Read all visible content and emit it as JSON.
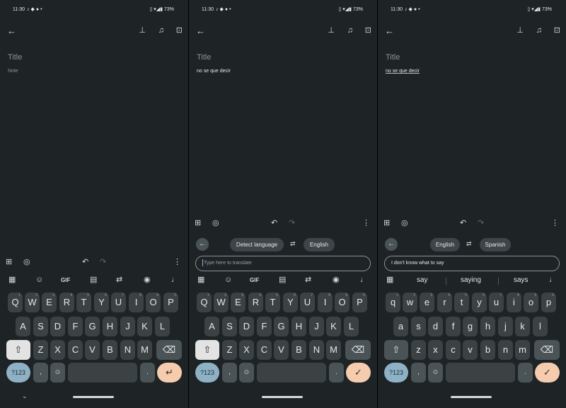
{
  "status": {
    "time": "11:30",
    "battery": "73%"
  },
  "icons": {
    "status_left": "notification-icons",
    "status_right": "wifi-signal-battery-icons",
    "back": "arrow-back-icon",
    "pin": "pin-icon",
    "reminder": "bell-plus-icon",
    "archive": "archive-icon",
    "add": "add-box-icon",
    "palette": "palette-icon",
    "undo": "undo-icon",
    "redo": "redo-icon",
    "more": "more-vert-icon",
    "apps": "apps-grid-icon",
    "sticker": "sticker-icon",
    "clipboard": "clipboard-icon",
    "translate": "translate-icon",
    "theme": "palette-icon",
    "mic": "mic-icon",
    "shift": "shift-icon",
    "backspace": "backspace-icon",
    "emoji": "emoji-icon",
    "enter": "enter-icon",
    "check": "check-icon",
    "swap": "swap-icon",
    "nav_down": "chevron-down-icon"
  },
  "panel1": {
    "title_placeholder": "Title",
    "note_placeholder": "Note",
    "gif_label": "GIF"
  },
  "panel2": {
    "title_placeholder": "Title",
    "note_text": "no se que decir",
    "gif_label": "GIF",
    "source_language": "Detect language",
    "target_language": "English",
    "input_placeholder": "Type here to translate"
  },
  "panel3": {
    "title_placeholder": "Title",
    "note_text": "no se que decir",
    "source_language": "English",
    "target_language": "Spanish",
    "input_text": "I don't know what to say",
    "suggestions": [
      "say",
      "saying",
      "says"
    ]
  },
  "keyboard": {
    "upper_row1": [
      "Q",
      "W",
      "E",
      "R",
      "T",
      "Y",
      "U",
      "I",
      "O",
      "P"
    ],
    "upper_row2": [
      "A",
      "S",
      "D",
      "F",
      "G",
      "H",
      "J",
      "K",
      "L"
    ],
    "upper_row3": [
      "Z",
      "X",
      "C",
      "V",
      "B",
      "N",
      "M"
    ],
    "lower_row1": [
      "q",
      "w",
      "e",
      "r",
      "t",
      "y",
      "u",
      "i",
      "o",
      "p"
    ],
    "lower_row2": [
      "a",
      "s",
      "d",
      "f",
      "g",
      "h",
      "j",
      "k",
      "l"
    ],
    "lower_row3": [
      "z",
      "x",
      "c",
      "v",
      "b",
      "n",
      "m"
    ],
    "number_hints": [
      "1",
      "2",
      "3",
      "4",
      "5",
      "6",
      "7",
      "8",
      "9",
      "0"
    ],
    "symbols_label": "?123",
    "comma": ",",
    "period": "."
  }
}
